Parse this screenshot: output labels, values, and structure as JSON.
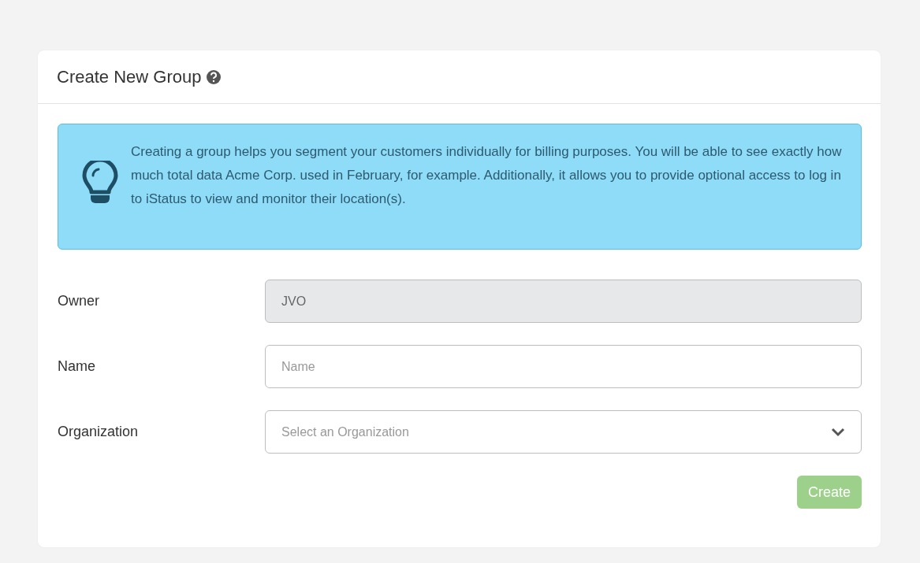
{
  "card": {
    "title": "Create New Group"
  },
  "info": {
    "text": "Creating a group helps you segment your customers individually for billing purposes. You will be able to see exactly how much total data Acme Corp. used in February, for example. Additionally, it allows you to provide optional access to log in to iStatus to view and monitor their location(s)."
  },
  "fields": [
    {
      "label": "Owner",
      "kind": "text",
      "value": "JVO",
      "disabled": true
    },
    {
      "label": "Name",
      "kind": "text",
      "placeholder": "Name",
      "disabled": false
    },
    {
      "label": "Organization",
      "kind": "select",
      "placeholder": "Select an Organization",
      "disabled": false
    }
  ],
  "submit": {
    "label": "Create",
    "disabled": true
  }
}
